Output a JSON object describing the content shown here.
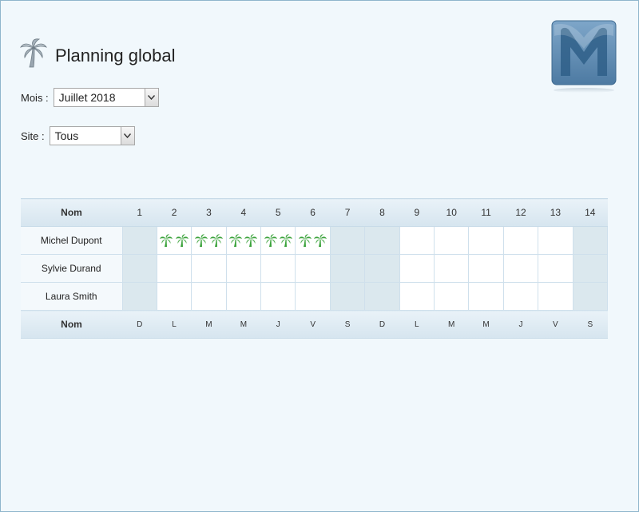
{
  "page": {
    "title": "Planning global",
    "title_icon": "palm-tree-icon",
    "logo_icon": "m-logo-icon"
  },
  "filters": {
    "month_label": "Mois :",
    "month_value": "Juillet 2018",
    "site_label": "Site :",
    "site_value": "Tous"
  },
  "planning": {
    "header_name": "Nom",
    "footer_name": "Nom",
    "days": [
      {
        "num": "1",
        "letter": "D",
        "weekend": true
      },
      {
        "num": "2",
        "letter": "L",
        "weekend": false
      },
      {
        "num": "3",
        "letter": "M",
        "weekend": false
      },
      {
        "num": "4",
        "letter": "M",
        "weekend": false
      },
      {
        "num": "5",
        "letter": "J",
        "weekend": false
      },
      {
        "num": "6",
        "letter": "V",
        "weekend": false
      },
      {
        "num": "7",
        "letter": "S",
        "weekend": true
      },
      {
        "num": "8",
        "letter": "D",
        "weekend": true
      },
      {
        "num": "9",
        "letter": "L",
        "weekend": false
      },
      {
        "num": "10",
        "letter": "M",
        "weekend": false
      },
      {
        "num": "11",
        "letter": "M",
        "weekend": false
      },
      {
        "num": "12",
        "letter": "J",
        "weekend": false
      },
      {
        "num": "13",
        "letter": "V",
        "weekend": false
      },
      {
        "num": "14",
        "letter": "S",
        "weekend": true
      }
    ],
    "rows": [
      {
        "name": "Michel Dupont",
        "vacation_days": [
          2,
          3,
          4,
          5,
          6
        ]
      },
      {
        "name": "Sylvie Durand",
        "vacation_days": []
      },
      {
        "name": "Laura Smith",
        "vacation_days": []
      }
    ],
    "vacation_icon": "palm-tree-icon",
    "colors": {
      "weekend": "#dbe8ee",
      "vacation": "#3aa23a"
    }
  }
}
